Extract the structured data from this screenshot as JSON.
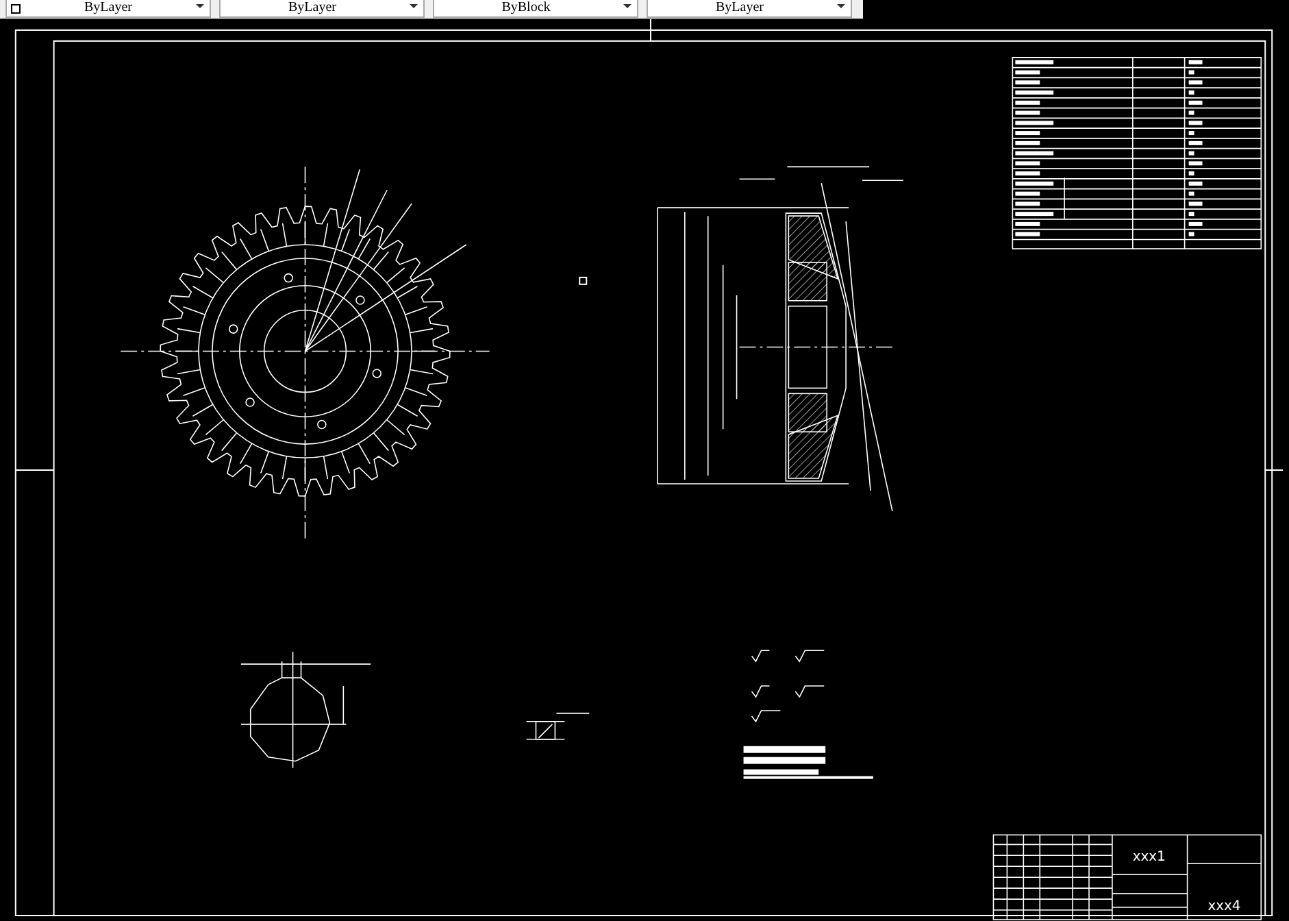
{
  "toolbar": {
    "dropdowns": [
      {
        "value": "ByLayer"
      },
      {
        "value": "ByLayer"
      },
      {
        "value": "ByBlock"
      },
      {
        "value": "ByLayer"
      }
    ]
  },
  "title_block": {
    "name": "xxx1",
    "code": "xxx4"
  }
}
